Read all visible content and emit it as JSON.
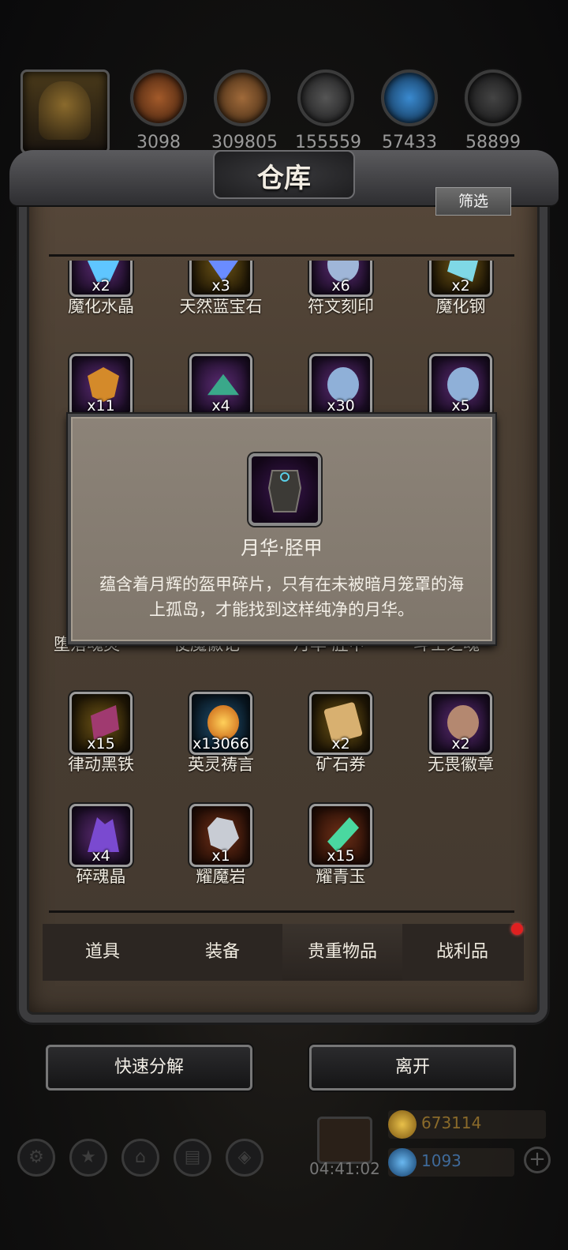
{
  "resources": [
    {
      "icon": "copper-ore-icon",
      "color": "#8a4b24",
      "amount": "3098"
    },
    {
      "icon": "wood-plank-icon",
      "color": "#8a5a30",
      "amount": "309805"
    },
    {
      "icon": "iron-ingot-icon",
      "color": "#3a3a3c",
      "amount": "155559"
    },
    {
      "icon": "blue-crystal-icon",
      "color": "#2a6aa0",
      "amount": "57433"
    },
    {
      "icon": "dark-iron-icon",
      "color": "#2b2b2d",
      "amount": "58899"
    }
  ],
  "warehouse": {
    "title": "仓库",
    "filter_label": "筛选"
  },
  "items": [
    {
      "name": "魔化水晶",
      "qty": "x2",
      "frame": "purple",
      "gem": "#5fc6ff"
    },
    {
      "name": "天然蓝宝石",
      "qty": "x3",
      "frame": "gold",
      "gem": "#6a8cff"
    },
    {
      "name": "符文刻印",
      "qty": "x6",
      "frame": "purple",
      "gem": "#9fb6d8"
    },
    {
      "name": "魔化钢",
      "qty": "x2",
      "frame": "gold",
      "gem": "#7fd8e6"
    },
    {
      "name": "",
      "qty": "x11",
      "frame": "purple",
      "gem": "#d48a2a"
    },
    {
      "name": "",
      "qty": "x4",
      "frame": "purple",
      "gem": "#3aa88a"
    },
    {
      "name": "",
      "qty": "x30",
      "frame": "purple",
      "gem": "#8fb0d8"
    },
    {
      "name": "",
      "qty": "x5",
      "frame": "purple",
      "gem": "#8fb0d8"
    },
    {
      "name": "律动黑铁",
      "qty": "x15",
      "frame": "gold",
      "gem": "#a03a70"
    },
    {
      "name": "英灵祷言",
      "qty": "x13066",
      "frame": "blue",
      "gem": "#f2a02a"
    },
    {
      "name": "矿石券",
      "qty": "x2",
      "frame": "gold",
      "gem": "#d8b070"
    },
    {
      "name": "无畏徽章",
      "qty": "x2",
      "frame": "purple",
      "gem": "#b48870"
    },
    {
      "name": "碎魂晶",
      "qty": "x4",
      "frame": "purple",
      "gem": "#7a4ad0"
    },
    {
      "name": "耀魔岩",
      "qty": "x1",
      "frame": "orange",
      "gem": "#c8ccd4"
    },
    {
      "name": "耀青玉",
      "qty": "x15",
      "frame": "orange",
      "gem": "#4ad8a0"
    }
  ],
  "hidden_row_labels": [
    "堕落魂灵",
    "使魔徽记",
    "月华·胫甲",
    "斗士之魂"
  ],
  "tooltip": {
    "name": "月华·胫甲",
    "description": "蕴含着月辉的盔甲碎片，只有在未被暗月笼罩的海上孤岛，才能找到这样纯净的月华。"
  },
  "tabs": [
    "道具",
    "装备",
    "贵重物品",
    "战利品"
  ],
  "active_tab": "贵重物品",
  "buttons": {
    "decompose": "快速分解",
    "leave": "离开"
  },
  "footer": {
    "timer": "04:41:02",
    "gold": "673114",
    "gems": "1093",
    "gold_color": "#c7972a",
    "gem_color": "#3f86c9"
  }
}
